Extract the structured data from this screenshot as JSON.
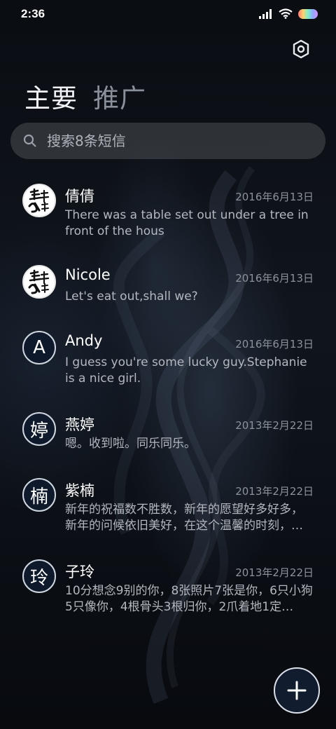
{
  "status_bar": {
    "time": "2:36"
  },
  "tabs": [
    {
      "label": "主要",
      "active": true
    },
    {
      "label": "推广",
      "active": false
    }
  ],
  "search": {
    "placeholder": "搜索8条短信"
  },
  "conversations": [
    {
      "avatar_type": "logo",
      "avatar_text": "",
      "name": "倩倩",
      "date": "2016年6月13日",
      "preview": "There was a table set out under a tree in front of the hous"
    },
    {
      "avatar_type": "logo",
      "avatar_text": "",
      "name": "Nicole",
      "date": "2016年6月13日",
      "preview": "Let's eat out,shall we?"
    },
    {
      "avatar_type": "letter",
      "avatar_text": "A",
      "name": "Andy",
      "date": "2016年6月13日",
      "preview": "I guess you're some lucky guy.Stephanie is a nice girl."
    },
    {
      "avatar_type": "letter",
      "avatar_text": "婷",
      "name": "燕婷",
      "date": "2013年2月22日",
      "preview": "嗯。收到啦。同乐同乐。"
    },
    {
      "avatar_type": "letter",
      "avatar_text": "楠",
      "name": "紫楠",
      "date": "2013年2月22日",
      "preview": "新年的祝福数不胜数，新年的愿望好多好多，新年的问候依旧美好，在这个温馨的时刻，…"
    },
    {
      "avatar_type": "letter",
      "avatar_text": "玲",
      "name": "子玲",
      "date": "2013年2月22日",
      "preview": "10分想念9别的你，8张照片7张是你，6只小狗5只像你，4根骨头3根归你，2爪着地1定…"
    }
  ],
  "colors": {
    "accent": "#111c2e",
    "background": "#0b0f15"
  },
  "icons": {
    "settings": "settings-hex-icon",
    "search": "search-icon",
    "compose": "plus-icon"
  }
}
